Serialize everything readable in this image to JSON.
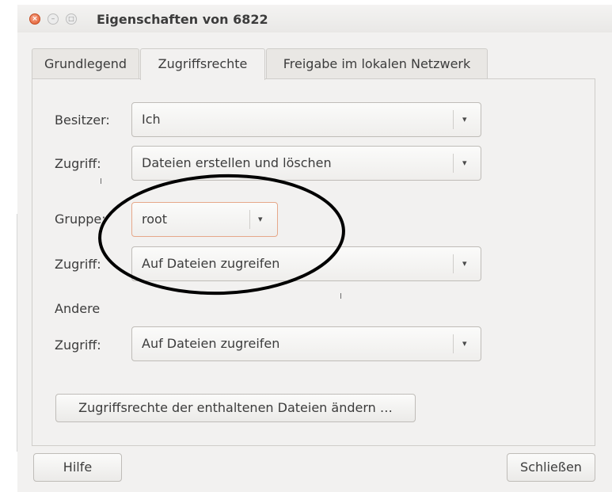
{
  "window": {
    "title": "Eigenschaften von 6822",
    "controls": {
      "close": "×",
      "minimize": "–",
      "maximize": "□"
    }
  },
  "tabs": [
    {
      "label": "Grundlegend",
      "active": false
    },
    {
      "label": "Zugriffsrechte",
      "active": true
    },
    {
      "label": "Freigabe im lokalen Netzwerk",
      "active": false
    }
  ],
  "owner": {
    "label": "Besitzer:",
    "value": "Ich",
    "access_label": "Zugriff:",
    "access_value": "Dateien erstellen und löschen"
  },
  "group": {
    "label": "Gruppe:",
    "value": "root",
    "access_label": "Zugriff:",
    "access_value": "Auf Dateien zugreifen"
  },
  "others": {
    "label": "Andere",
    "access_label": "Zugriff:",
    "access_value": "Auf Dateien zugreifen"
  },
  "change_children_button": "Zugriffsrechte der enthaltenen Dateien ändern …",
  "footer": {
    "help": "Hilfe",
    "close": "Schließen"
  },
  "icons": {
    "dropdown_arrow": "▾"
  },
  "colors": {
    "close_button": "#e05a2b",
    "focus_border": "#e6a88a",
    "annotation": "#000000"
  }
}
